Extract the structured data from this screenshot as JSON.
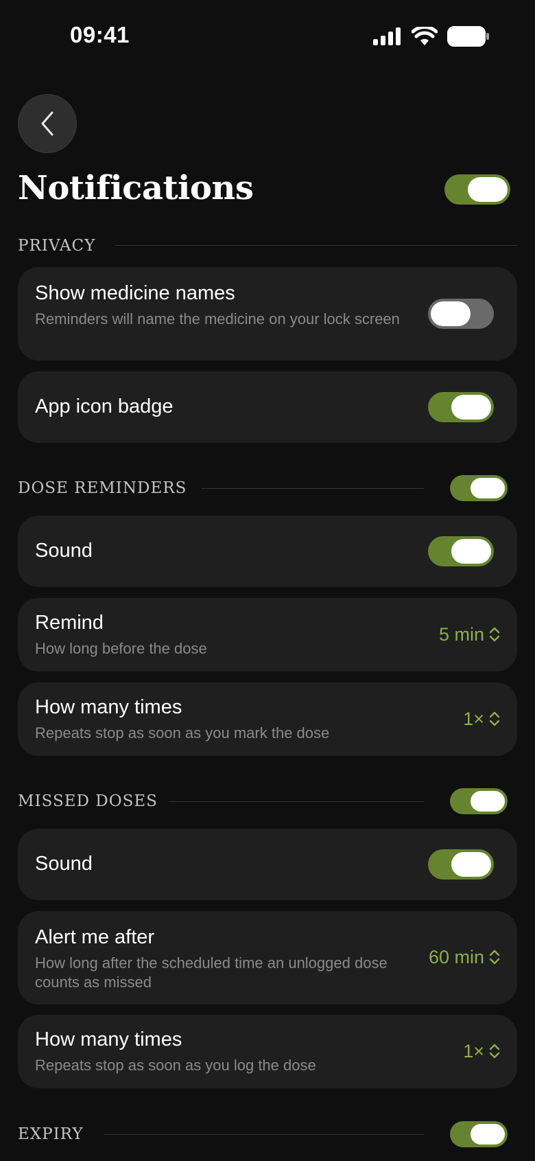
{
  "status_bar": {
    "time": "09:41"
  },
  "header": {
    "title": "Notifications",
    "master_toggle_on": true
  },
  "sections": {
    "privacy": {
      "label": "PRIVACY",
      "show_names": {
        "title": "Show medicine names",
        "subtitle": "Reminders will name the medicine on your lock screen",
        "on": false
      },
      "badge": {
        "title": "App icon badge",
        "on": true
      }
    },
    "dose_reminders": {
      "label": "DOSE REMINDERS",
      "on": true,
      "sound": {
        "title": "Sound",
        "on": true
      },
      "remind": {
        "title": "Remind",
        "subtitle": "How long before the dose",
        "value": "5 min"
      },
      "times": {
        "title": "How many times",
        "subtitle": "Repeats stop as soon as you mark the dose",
        "value": "1×"
      }
    },
    "missed_doses": {
      "label": "MISSED DOSES",
      "on": true,
      "sound": {
        "title": "Sound",
        "on": true
      },
      "alert_after": {
        "title": "Alert me after",
        "subtitle": "How long after the scheduled time an unlogged dose counts as missed",
        "value": "60 min"
      },
      "times": {
        "title": "How many times",
        "subtitle": "Repeats stop as soon as you log the dose",
        "value": "1×"
      }
    },
    "expiry": {
      "label": "EXPIRY",
      "on": true
    }
  },
  "colors": {
    "accent": "#66842f",
    "value_text": "#8fae4a",
    "card_bg": "#1f1f1f",
    "page_bg": "#0f0f0f"
  },
  "icons": [
    "signal-icon",
    "wifi-icon",
    "battery-icon",
    "chevron-left-icon",
    "chevron-up-down-icon"
  ]
}
